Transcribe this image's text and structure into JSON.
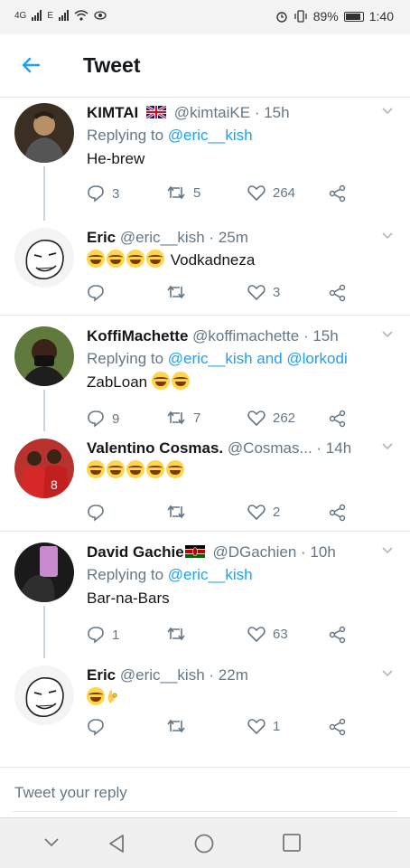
{
  "status_bar": {
    "network_1": "4G",
    "network_2": "E",
    "battery": "89%",
    "time": "1:40"
  },
  "header": {
    "title": "Tweet"
  },
  "tweets": [
    {
      "name": "KIMTAI",
      "handle": "@kimtaiKE",
      "time": "· 15h",
      "reply_prefix": "Replying to",
      "reply_mentions": "@eric__kish",
      "text": "He-brew",
      "replies": "3",
      "retweets": "5",
      "likes": "264",
      "flag": "uk-flag-icon"
    },
    {
      "name": "Eric",
      "handle": "@eric__kish",
      "time": "· 25m",
      "text": "Vodkadneza",
      "replies": "",
      "retweets": "",
      "likes": "3"
    },
    {
      "name": "KoffiMachette",
      "handle": "@koffimachette",
      "time": "· 15h",
      "reply_prefix": "Replying to",
      "reply_mentions": "@eric__kish and @lorkodi",
      "text": "ZabLoan",
      "replies": "9",
      "retweets": "7",
      "likes": "262"
    },
    {
      "name": "Valentino Cosmas.",
      "handle": "@Cosmas...",
      "time": "· 14h",
      "text": "",
      "replies": "",
      "retweets": "",
      "likes": "2"
    },
    {
      "name": "David Gachie",
      "handle": "@DGachien",
      "time": "· 10h",
      "reply_prefix": "Replying to",
      "reply_mentions": "@eric__kish",
      "text": "Bar-na-Bars",
      "replies": "1",
      "retweets": "",
      "likes": "63",
      "flag": "kenya-flag-icon"
    },
    {
      "name": "Eric",
      "handle": "@eric__kish",
      "time": "· 22m",
      "text": "",
      "replies": "",
      "retweets": "",
      "likes": "1"
    }
  ],
  "reply_bar": {
    "placeholder": "Tweet your reply"
  },
  "colors": {
    "accent": "#1da1f2",
    "muted": "#657786",
    "divider": "#e1e8ed"
  }
}
